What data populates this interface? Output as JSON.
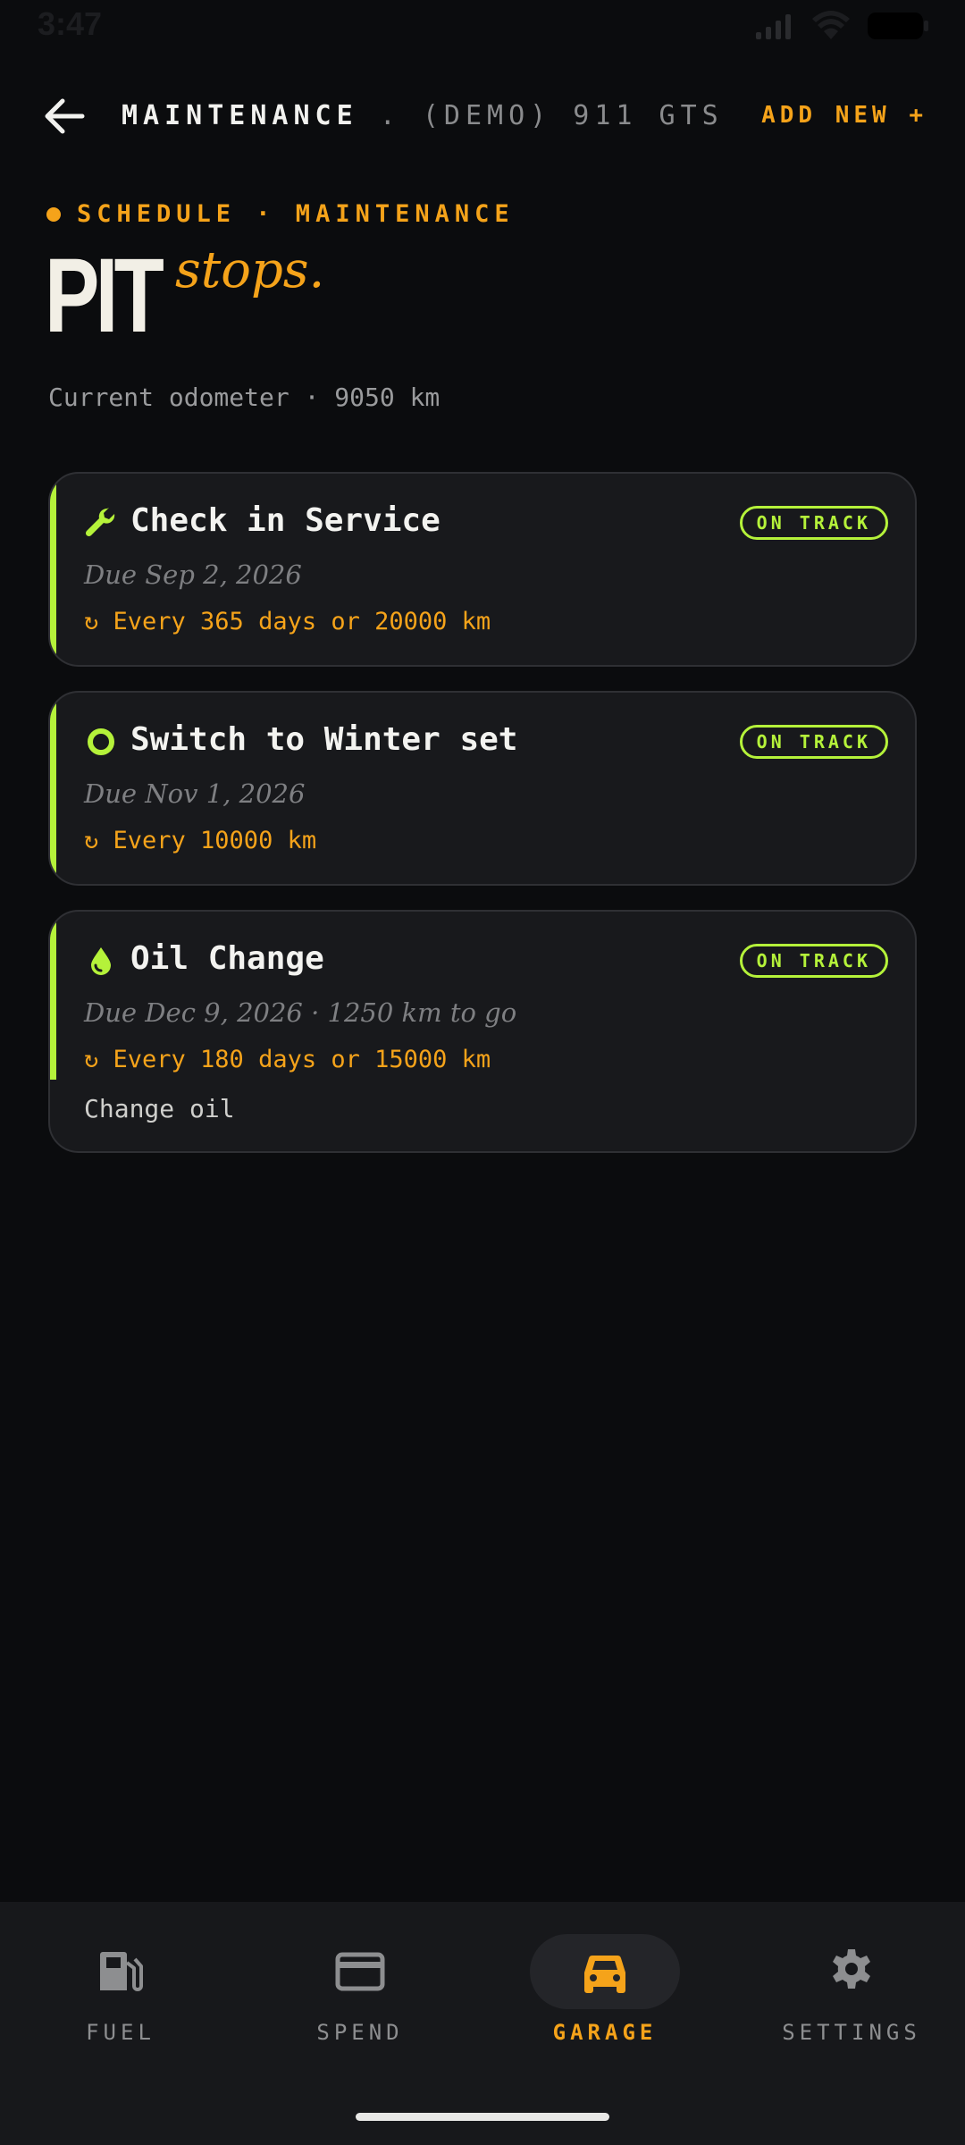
{
  "status_bar": {
    "time": "3:47"
  },
  "header": {
    "back_icon": "arrow-left-icon",
    "title": "MAINTENANCE",
    "separator": ".",
    "vehicle": "(DEMO) 911 GTS",
    "add_new": "ADD NEW +"
  },
  "eyebrow": "SCHEDULE · MAINTENANCE",
  "hero": {
    "main": "PIT",
    "script": "stops."
  },
  "odometer": "Current odometer · 9050 km",
  "cards": [
    {
      "icon": "wrench-icon",
      "title": "Check in Service",
      "badge": "ON TRACK",
      "due": "Due Sep 2, 2026",
      "repeat": "↻  Every 365 days or 20000 km",
      "note": ""
    },
    {
      "icon": "ring-icon",
      "title": "Switch to Winter set",
      "badge": "ON TRACK",
      "due": "Due Nov 1, 2026",
      "repeat": "↻  Every 10000 km",
      "note": ""
    },
    {
      "icon": "drop-icon",
      "title": "Oil Change",
      "badge": "ON TRACK",
      "due": "Due Dec 9, 2026 · 1250 km to go",
      "repeat": "↻  Every 180 days or 15000 km",
      "note": "Change oil"
    }
  ],
  "nav": [
    {
      "label": "FUEL",
      "icon": "fuel-pump-icon",
      "active": false
    },
    {
      "label": "SPEND",
      "icon": "credit-card-icon",
      "active": false
    },
    {
      "label": "GARAGE",
      "icon": "car-icon",
      "active": true
    },
    {
      "label": "SETTINGS",
      "icon": "gear-icon",
      "active": false
    }
  ],
  "colors": {
    "accent": "#f5a31a",
    "status_ok": "#b5f23a",
    "background": "#0b0c0e",
    "card": "#18191c"
  }
}
